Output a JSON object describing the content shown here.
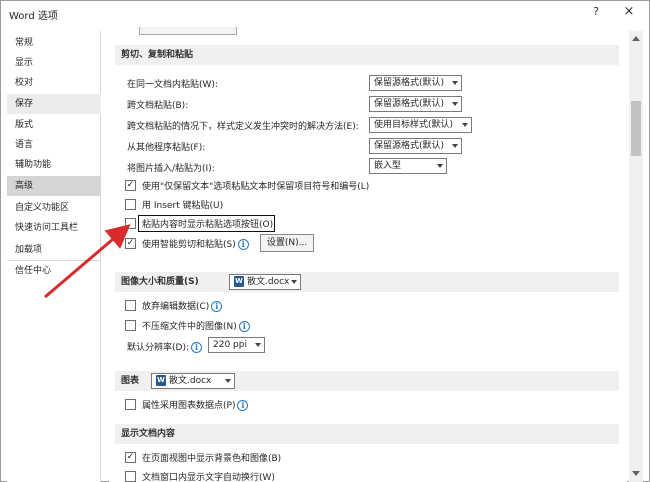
{
  "window": {
    "title": "Word 选项",
    "help": "?",
    "close": "×"
  },
  "nav": {
    "items": [
      {
        "label": "常规"
      },
      {
        "label": "显示"
      },
      {
        "label": "校对"
      },
      {
        "label": "保存"
      },
      {
        "label": "版式"
      },
      {
        "label": "语言"
      },
      {
        "label": "辅助功能"
      },
      {
        "label": "高级"
      },
      {
        "label": "自定义功能区"
      },
      {
        "label": "快速访问工具栏"
      },
      {
        "label": "加载项"
      },
      {
        "label": "信任中心"
      }
    ],
    "hovered_index": 3,
    "selected_index": 7
  },
  "cut_copy_paste": {
    "header": "剪切、复制和粘贴",
    "rows": [
      {
        "label": "在同一文档内粘贴(W):",
        "value": "保留源格式(默认)"
      },
      {
        "label": "跨文档粘贴(B):",
        "value": "保留源格式(默认)"
      },
      {
        "label": "跨文档粘贴的情况下，样式定义发生冲突时的解决方法(E):",
        "value": "使用目标样式(默认)"
      },
      {
        "label": "从其他程序粘贴(F):",
        "value": "保留源格式(默认)"
      },
      {
        "label": "将图片插入/粘贴为(I):",
        "value": "嵌入型"
      }
    ],
    "checks": {
      "smart_keep_bullets": {
        "label": "使用\"仅保留文本\"选项粘贴文本时保留项目符号和编号(L)",
        "checked": true
      },
      "insert_key": {
        "label": "用 Insert 键粘贴(U)",
        "checked": false
      },
      "show_paste_button": {
        "label": "粘贴内容时显示粘贴选项按钮(O)",
        "checked": false
      },
      "smart_cut_paste": {
        "label": "使用智能剪切和粘贴(S)",
        "checked": true
      }
    },
    "settings_button": "设置(N)..."
  },
  "image_quality": {
    "header": "图像大小和质量(S)",
    "doc": "散文.docx",
    "discard_edit": {
      "label": "放弃编辑数据(C)",
      "checked": false
    },
    "no_compress": {
      "label": "不压缩文件中的图像(N)",
      "checked": false
    },
    "resolution_label": "默认分辨率(D):",
    "resolution_value": "220 ppi"
  },
  "charts": {
    "header": "图表",
    "doc": "散文.docx",
    "properties_follow": {
      "label": "属性采用图表数据点(P)",
      "checked": false
    }
  },
  "show_content": {
    "header": "显示文档内容",
    "bg_colors": {
      "label": "在页面视图中显示背景色和图像(B)",
      "checked": true
    },
    "wrap_text": {
      "label": "文档窗口内显示文字自动换行(W)",
      "checked": false
    }
  },
  "icons": {
    "info": "i",
    "check": "✓",
    "doc": "W"
  },
  "colors": {
    "arrow": "#d92b2b",
    "selected_nav": "#d5d5d5",
    "info": "#2b78c5",
    "section_bg": "#f0f0f0"
  }
}
